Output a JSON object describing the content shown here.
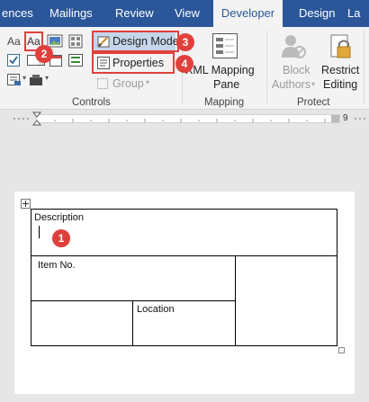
{
  "tabs": [
    {
      "label": "ences",
      "active": false
    },
    {
      "label": "Mailings",
      "active": false
    },
    {
      "label": "Review",
      "active": false
    },
    {
      "label": "View",
      "active": false
    },
    {
      "label": "Developer",
      "active": true
    },
    {
      "label": "Design",
      "active": false
    },
    {
      "label": "La",
      "active": false
    }
  ],
  "ribbon": {
    "controls": {
      "group_label": "Controls",
      "design_mode_label": "Design Mode",
      "properties_label": "Properties",
      "group_button_label": "Group",
      "rich_text_icon_text": "Aa",
      "plain_text_icon_text": "Aa"
    },
    "mapping": {
      "group_label": "Mapping",
      "xml_line1": "XML Mapping",
      "xml_line2": "Pane"
    },
    "protect": {
      "group_label": "Protect",
      "block_line1": "Block",
      "block_line2": "Authors",
      "restrict_line1": "Restrict",
      "restrict_line2": "Editing"
    }
  },
  "ruler": {
    "right_number": "9"
  },
  "badges": [
    "1",
    "2",
    "3",
    "4"
  ],
  "document": {
    "description_label": "Description",
    "item_no_label": "Item No.",
    "location_label": "Location"
  },
  "colors": {
    "accent": "#2b579a",
    "highlight": "#e0403c",
    "ribbon_bg": "#f3f3f3"
  }
}
